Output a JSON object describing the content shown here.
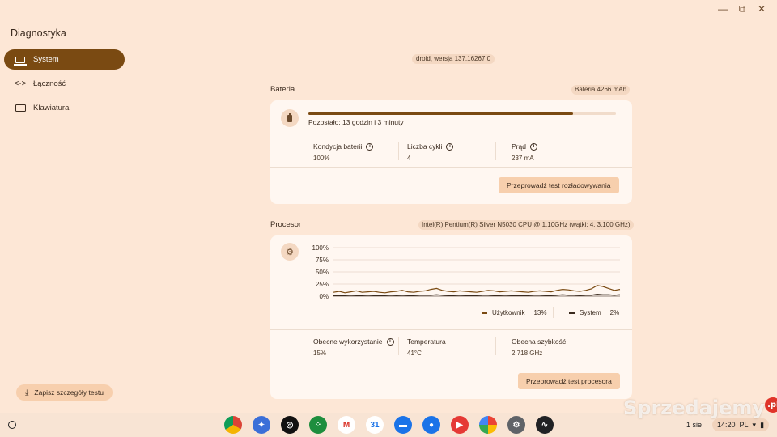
{
  "app": {
    "title": "Diagnostyka"
  },
  "sidebar": {
    "items": [
      {
        "label": "System",
        "icon": "laptop-icon",
        "active": true
      },
      {
        "label": "Łączność",
        "icon": "connectivity-icon",
        "active": false
      },
      {
        "label": "Klawiatura",
        "icon": "keyboard-icon",
        "active": false
      }
    ],
    "save_label": "Zapisz szczegóły testu"
  },
  "version": "droid, wersja 137.16267.0",
  "battery": {
    "title": "Bateria",
    "capacity": "Bateria 4266 mAh",
    "remaining": "Pozostało: 13 godzin i 3 minuty",
    "charge_fraction": 0.86,
    "stats": [
      {
        "label": "Kondycja baterii",
        "value": "100%"
      },
      {
        "label": "Liczba cykli",
        "value": "4"
      },
      {
        "label": "Prąd",
        "value": "237 mA"
      }
    ],
    "test_button": "Przeprowadź test rozładowywania"
  },
  "cpu": {
    "title": "Procesor",
    "model": "Intel(R) Pentium(R) Silver N5030 CPU @ 1.10GHz (wątki: 4, 3.100 GHz)",
    "legend": [
      {
        "name": "Użytkownik",
        "value": "13%",
        "color": "#7a4a12"
      },
      {
        "name": "System",
        "value": "2%",
        "color": "#3a2a1e"
      }
    ],
    "stats": [
      {
        "label": "Obecne wykorzystanie",
        "value": "15%"
      },
      {
        "label": "Temperatura",
        "value": "41°C"
      },
      {
        "label": "Obecna szybkość",
        "value": "2.718 GHz"
      }
    ],
    "test_button": "Przeprowadź test procesora"
  },
  "chart_data": {
    "type": "line",
    "ylim": [
      0,
      100
    ],
    "yticks": [
      "100%",
      "75%",
      "50%",
      "25%",
      "0%"
    ],
    "series": [
      {
        "name": "Użytkownik",
        "values": [
          8,
          10,
          7,
          9,
          11,
          8,
          9,
          10,
          8,
          7,
          9,
          10,
          12,
          9,
          8,
          10,
          11,
          14,
          16,
          12,
          10,
          9,
          11,
          10,
          9,
          8,
          10,
          12,
          11,
          9,
          10,
          11,
          10,
          9,
          8,
          10,
          11,
          10,
          9,
          12,
          14,
          13,
          11,
          10,
          12,
          15,
          22,
          20,
          16,
          12,
          14
        ]
      },
      {
        "name": "System",
        "values": [
          1,
          1,
          1,
          2,
          1,
          1,
          2,
          1,
          1,
          1,
          2,
          1,
          2,
          1,
          1,
          2,
          2,
          2,
          3,
          2,
          1,
          1,
          2,
          1,
          1,
          1,
          2,
          2,
          1,
          1,
          2,
          1,
          1,
          1,
          1,
          2,
          2,
          1,
          1,
          2,
          3,
          2,
          2,
          1,
          2,
          2,
          4,
          3,
          3,
          2,
          3
        ]
      }
    ]
  },
  "taskbar": {
    "apps": [
      "chrome-icon",
      "assistant-icon",
      "podcast-icon",
      "app-grid-icon",
      "gmail-icon",
      "calendar-icon",
      "files-icon",
      "messages-icon",
      "youtube-icon",
      "photos-icon",
      "settings-icon",
      "diagnostics-icon"
    ],
    "date": "1 sie",
    "time": "14:20",
    "lang": "PL"
  },
  "watermark": {
    "text": "Sprzedajemy",
    "suffix": ".pl"
  }
}
